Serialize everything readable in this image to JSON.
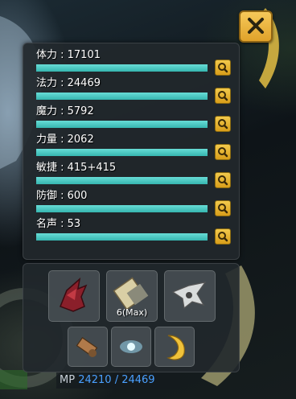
{
  "stats": [
    {
      "label": "体力 : 17101",
      "fill": 1.0
    },
    {
      "label": "法力 : 24469",
      "fill": 1.0
    },
    {
      "label": "魔力 : 5792",
      "fill": 1.0
    },
    {
      "label": "力量 : 2062",
      "fill": 1.0
    },
    {
      "label": "敏捷 : 415+415",
      "fill": 1.0
    },
    {
      "label": "防御 : 600",
      "fill": 1.0
    },
    {
      "label": "名声 : 53",
      "fill": 1.0
    }
  ],
  "equipment": {
    "row1": [
      {
        "icon": "red-dragon-helm-icon",
        "caption": ""
      },
      {
        "icon": "scroll-bundle-icon",
        "caption": "6(Max)"
      },
      {
        "icon": "winged-mount-icon",
        "caption": ""
      }
    ],
    "row2": [
      {
        "icon": "bronze-cannon-icon",
        "caption": ""
      },
      {
        "icon": "glowing-orb-icon",
        "caption": ""
      },
      {
        "icon": "golden-crescent-icon",
        "caption": ""
      }
    ]
  },
  "mp": {
    "label": "MP",
    "value": "24210 / 24469"
  },
  "colors": {
    "bar": "#4ac9c3",
    "accent": "#e8b33a",
    "panel": "#21282c"
  }
}
